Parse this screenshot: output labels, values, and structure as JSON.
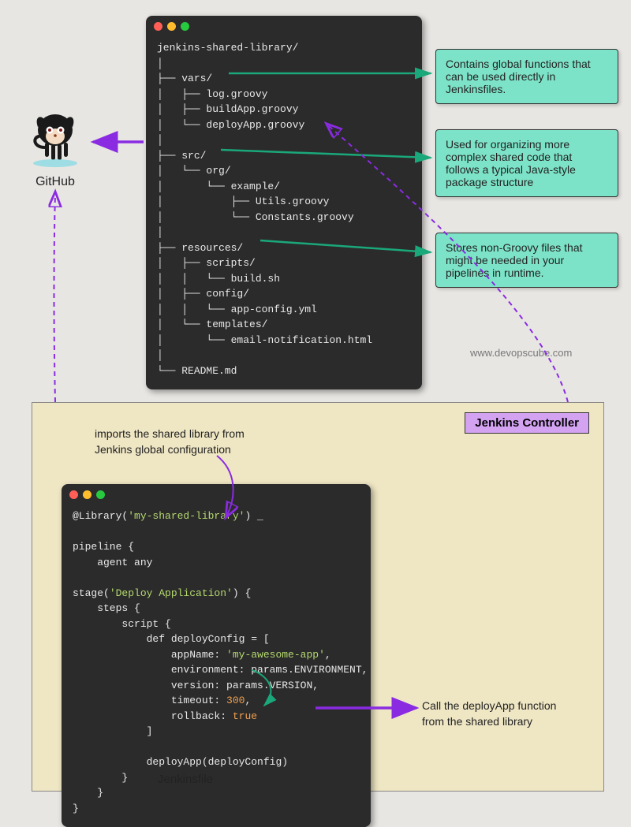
{
  "github": {
    "label": "GitHub"
  },
  "tree": {
    "root": "jenkins-shared-library/",
    "vars": {
      "dir": "vars/",
      "files": [
        "log.groovy",
        "buildApp.groovy",
        "deployApp.groovy"
      ]
    },
    "src": {
      "dir": "src/",
      "org": "org/",
      "example": "example/",
      "files": [
        "Utils.groovy",
        "Constants.groovy"
      ]
    },
    "resources": {
      "dir": "resources/",
      "scripts": {
        "dir": "scripts/",
        "file": "build.sh"
      },
      "config": {
        "dir": "config/",
        "file": "app-config.yml"
      },
      "templates": {
        "dir": "templates/",
        "file": "email-notification.html"
      }
    },
    "readme": "README.md"
  },
  "annotations": {
    "vars": "Contains global  functions that can be used directly in Jenkinsfiles.",
    "src": "Used for organizing more complex shared code that follows a typical Java-style package structure",
    "resources": "Stores non-Groovy files that might be needed in your pipelines in runtime."
  },
  "jenkins": {
    "panel_label": "Jenkins Controller",
    "import_note": "imports the shared library from\nJenkins global configuration",
    "call_note": "Call the deployApp function\nfrom the shared library",
    "jenkinsfile_label": "Jenkinsfile"
  },
  "code": {
    "library_decl": "@Library(",
    "library_name": "'my-shared-library'",
    "library_tail": ") _",
    "pipeline": "pipeline {",
    "agent": "    agent any",
    "stage_open": "stage(",
    "stage_name": "'Deploy Application'",
    "stage_tail": ") {",
    "steps": "    steps {",
    "script": "        script {",
    "def": "            def deployConfig = [",
    "appName_k": "                appName: ",
    "appName_v": "'my-awesome-app'",
    "comma": ",",
    "env_line": "                environment: params.ENVIRONMENT,",
    "ver_line": "                version: params.VERSION,",
    "timeout_k": "                timeout: ",
    "timeout_v": "300",
    "rollback_k": "                rollback: ",
    "rollback_v": "true",
    "close_arr": "            ]",
    "blank": "",
    "call": "            deployApp(deployConfig)",
    "brace": "        }",
    "brace2": "    }",
    "brace3": "}"
  },
  "website": "www.devopscube.com"
}
